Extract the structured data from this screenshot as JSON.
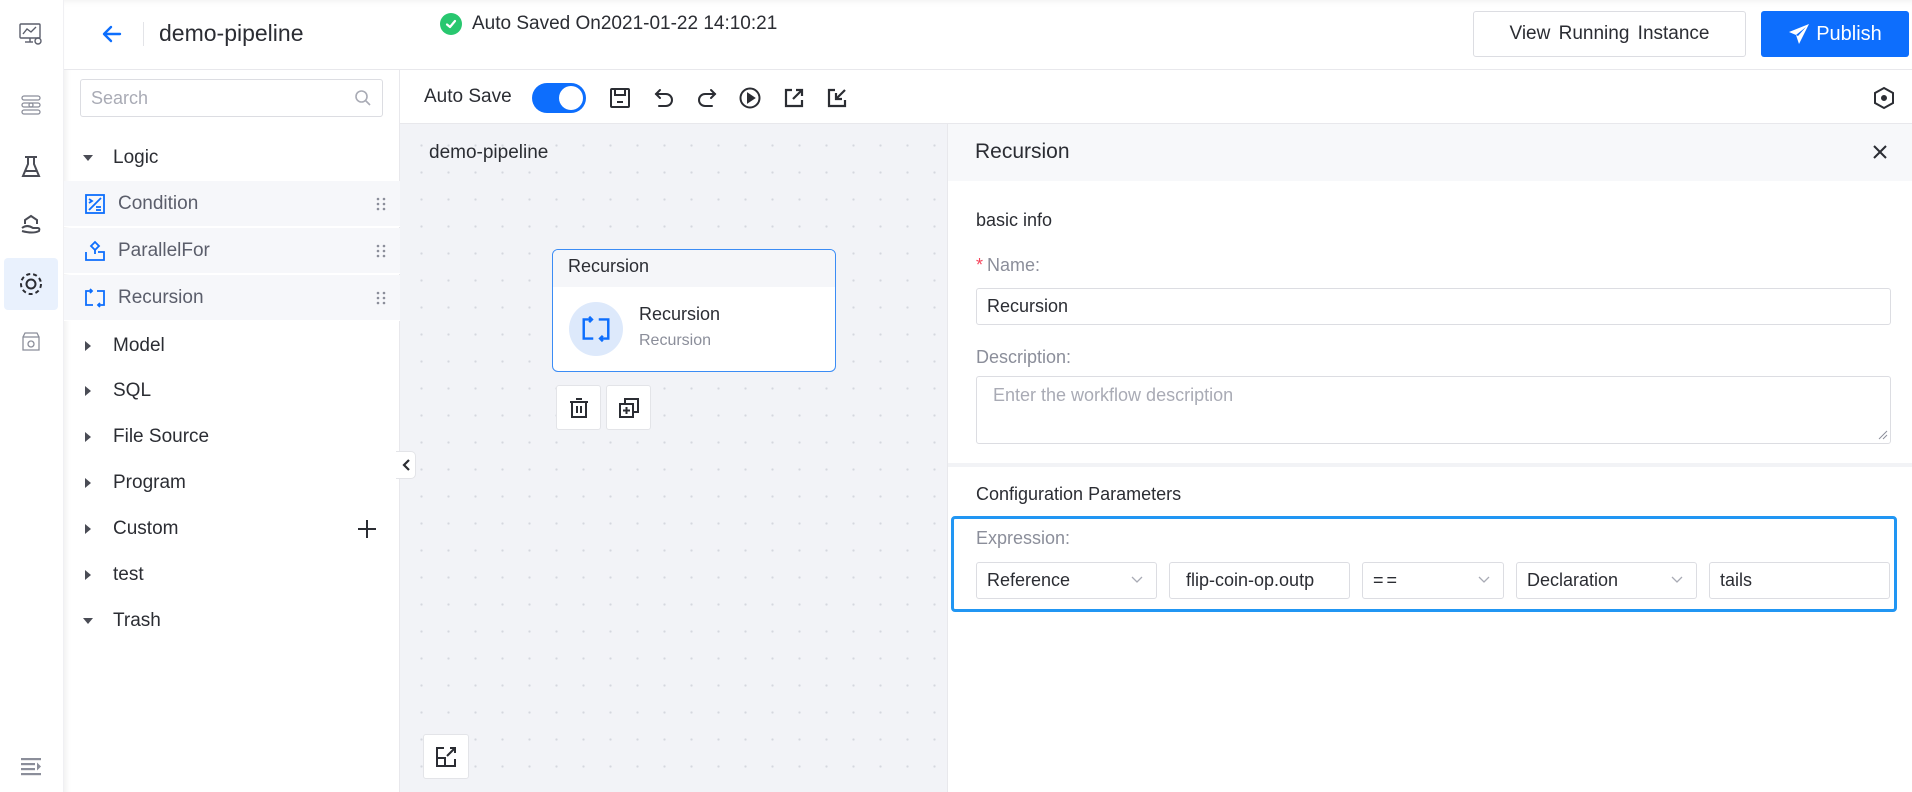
{
  "header": {
    "title": "demo-pipeline",
    "saved_message": "Auto Saved On2021-01-22 14:10:21",
    "view_running_label": "View Running Instance",
    "publish_label": "Publish"
  },
  "rail": {
    "items": [
      {
        "icon": "monitor-chart-gear-icon"
      },
      {
        "icon": "data-flow-icon"
      },
      {
        "icon": "flask-icon"
      },
      {
        "icon": "hand-house-icon"
      },
      {
        "icon": "pipeline-circle-icon",
        "active": true
      },
      {
        "icon": "box-gear-icon"
      }
    ],
    "bottom_icon": "expand-menu-icon"
  },
  "sidebar": {
    "search_placeholder": "Search",
    "groups": [
      {
        "label": "Logic",
        "expanded": true,
        "children": [
          {
            "label": "Condition",
            "icon": "condition-icon"
          },
          {
            "label": "ParallelFor",
            "icon": "parallel-for-icon"
          },
          {
            "label": "Recursion",
            "icon": "recursion-icon"
          }
        ]
      },
      {
        "label": "Model",
        "expanded": false
      },
      {
        "label": "SQL",
        "expanded": false
      },
      {
        "label": "File Source",
        "expanded": false
      },
      {
        "label": "Program",
        "expanded": false
      },
      {
        "label": "Custom",
        "expanded": false
      },
      {
        "label": "test",
        "expanded": false
      },
      {
        "label": "Trash",
        "expanded": true
      }
    ]
  },
  "toolbar": {
    "auto_save_label": "Auto Save",
    "auto_save_on": true,
    "icons": [
      "save-icon",
      "undo-icon",
      "redo-icon",
      "run-icon",
      "export-icon",
      "import-icon"
    ],
    "right_icon": "hexagon-settings-icon"
  },
  "canvas": {
    "title": "demo-pipeline",
    "node": {
      "header": "Recursion",
      "name": "Recursion",
      "type": "Recursion"
    }
  },
  "panel": {
    "title": "Recursion",
    "basic_info_title": "basic info",
    "name_label": "Name:",
    "name_value": "Recursion",
    "description_label": "Description:",
    "description_placeholder": "Enter the workflow description",
    "config_title": "Configuration Parameters",
    "expression_label": "Expression:",
    "expression": {
      "left_type": "Reference",
      "left_value": "flip-coin-op.outp",
      "operator": "==",
      "right_type": "Declaration",
      "right_value": "tails"
    }
  },
  "colors": {
    "primary": "#0d6efd",
    "success": "#28c76f",
    "highlight_border": "#2196f3",
    "required": "#f5455c"
  }
}
